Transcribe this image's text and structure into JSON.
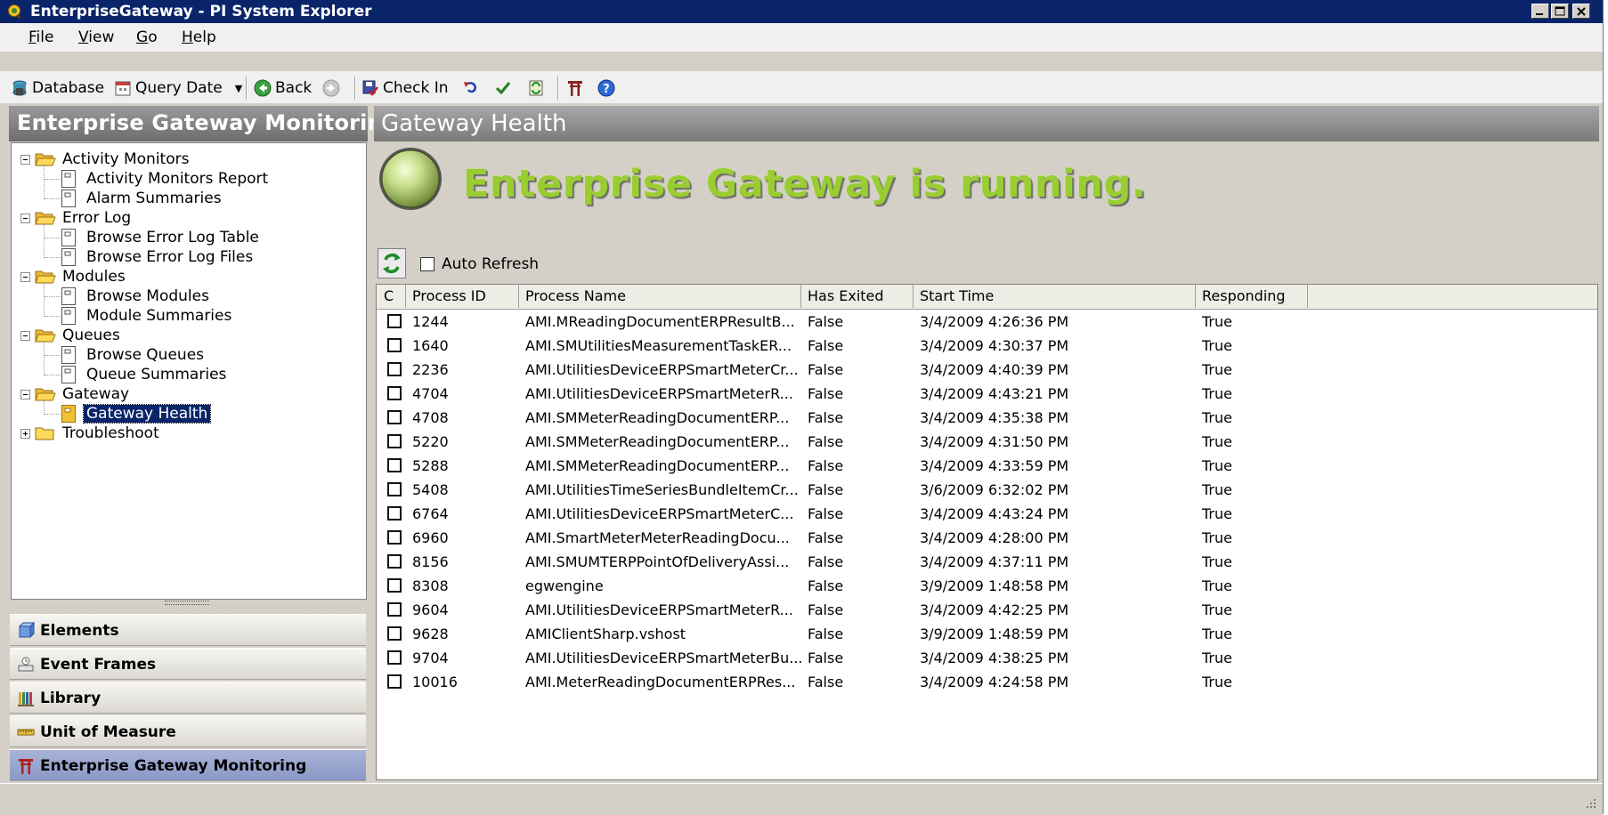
{
  "window": {
    "title": "EnterpriseGateway - PI System Explorer"
  },
  "menu": [
    {
      "label": "File",
      "accel": "F",
      "rest": "ile"
    },
    {
      "label": "View",
      "accel": "V",
      "rest": "iew"
    },
    {
      "label": "Go",
      "accel": "G",
      "rest": "o"
    },
    {
      "label": "Help",
      "accel": "H",
      "rest": "elp"
    }
  ],
  "toolbar": {
    "database": "Database",
    "query_date": "Query Date",
    "back": "Back",
    "check_in": "Check In"
  },
  "left": {
    "header": "Enterprise Gateway Monitoring",
    "tree": [
      {
        "label": "Activity Monitors",
        "type": "folder",
        "level": 0,
        "expanded": true
      },
      {
        "label": "Activity Monitors Report",
        "type": "item",
        "level": 1
      },
      {
        "label": "Alarm Summaries",
        "type": "item",
        "level": 1
      },
      {
        "label": "Error Log",
        "type": "folder",
        "level": 0,
        "expanded": true
      },
      {
        "label": "Browse Error Log Table",
        "type": "item",
        "level": 1
      },
      {
        "label": "Browse Error Log Files",
        "type": "item",
        "level": 1
      },
      {
        "label": "Modules",
        "type": "folder",
        "level": 0,
        "expanded": true
      },
      {
        "label": "Browse Modules",
        "type": "item",
        "level": 1
      },
      {
        "label": "Module Summaries",
        "type": "item",
        "level": 1
      },
      {
        "label": "Queues",
        "type": "folder",
        "level": 0,
        "expanded": true
      },
      {
        "label": "Browse Queues",
        "type": "item",
        "level": 1
      },
      {
        "label": "Queue Summaries",
        "type": "item",
        "level": 1
      },
      {
        "label": "Gateway",
        "type": "folder",
        "level": 0,
        "expanded": true
      },
      {
        "label": "Gateway Health",
        "type": "item",
        "level": 1,
        "selected": true
      },
      {
        "label": "Troubleshoot",
        "type": "folder",
        "level": 0,
        "expanded": false
      }
    ],
    "nav_buttons": [
      {
        "label": "Elements",
        "icon": "elements-icon"
      },
      {
        "label": "Event Frames",
        "icon": "event-frames-icon"
      },
      {
        "label": "Library",
        "icon": "library-icon"
      },
      {
        "label": "Unit of Measure",
        "icon": "ruler-icon"
      },
      {
        "label": "Enterprise Gateway Monitoring",
        "icon": "gateway-icon",
        "active": true
      }
    ]
  },
  "right": {
    "header": "Gateway Health",
    "status_text": "Enterprise Gateway is running.",
    "auto_refresh_label": "Auto Refresh",
    "auto_refresh_checked": false,
    "columns": [
      "C",
      "Process ID",
      "Process Name",
      "Has Exited",
      "Start Time",
      "Responding"
    ],
    "rows": [
      [
        "1244",
        "AMI.MReadingDocumentERPResultB...",
        "False",
        "3/4/2009 4:26:36 PM",
        "True"
      ],
      [
        "1640",
        "AMI.SMUtilitiesMeasurementTaskER...",
        "False",
        "3/4/2009 4:30:37 PM",
        "True"
      ],
      [
        "2236",
        "AMI.UtilitiesDeviceERPSmartMeterCr...",
        "False",
        "3/4/2009 4:40:39 PM",
        "True"
      ],
      [
        "4704",
        "AMI.UtilitiesDeviceERPSmartMeterR...",
        "False",
        "3/4/2009 4:43:21 PM",
        "True"
      ],
      [
        "4708",
        "AMI.SMMeterReadingDocumentERP...",
        "False",
        "3/4/2009 4:35:38 PM",
        "True"
      ],
      [
        "5220",
        "AMI.SMMeterReadingDocumentERP...",
        "False",
        "3/4/2009 4:31:50 PM",
        "True"
      ],
      [
        "5288",
        "AMI.SMMeterReadingDocumentERP...",
        "False",
        "3/4/2009 4:33:59 PM",
        "True"
      ],
      [
        "5408",
        "AMI.UtilitiesTimeSeriesBundleItemCr...",
        "False",
        "3/6/2009 6:32:02 PM",
        "True"
      ],
      [
        "6764",
        "AMI.UtilitiesDeviceERPSmartMeterC...",
        "False",
        "3/4/2009 4:43:24 PM",
        "True"
      ],
      [
        "6960",
        "AMI.SmartMeterMeterReadingDocu...",
        "False",
        "3/4/2009 4:28:00 PM",
        "True"
      ],
      [
        "8156",
        "AMI.SMUMTERPPointOfDeliveryAssi...",
        "False",
        "3/4/2009 4:37:11 PM",
        "True"
      ],
      [
        "8308",
        "egwengine",
        "False",
        "3/9/2009 1:48:58 PM",
        "True"
      ],
      [
        "9604",
        "AMI.UtilitiesDeviceERPSmartMeterR...",
        "False",
        "3/4/2009 4:42:25 PM",
        "True"
      ],
      [
        "9628",
        "AMIClientSharp.vshost",
        "False",
        "3/9/2009 1:48:59 PM",
        "True"
      ],
      [
        "9704",
        "AMI.UtilitiesDeviceERPSmartMeterBu...",
        "False",
        "3/4/2009 4:38:25 PM",
        "True"
      ],
      [
        "10016",
        "AMI.MeterReadingDocumentERPRes...",
        "False",
        "3/4/2009 4:24:58 PM",
        "True"
      ]
    ]
  },
  "colors": {
    "titlebar": "#0a246a",
    "status_green": "#9acd32",
    "selection": "#0a246a",
    "header_gray": "#7a7a7a"
  }
}
